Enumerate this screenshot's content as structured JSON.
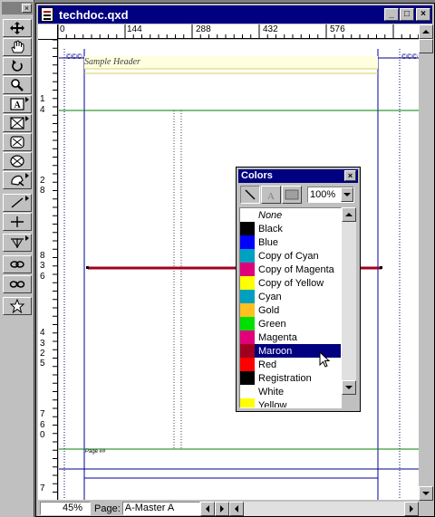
{
  "tools_palette": {
    "tools": [
      {
        "name": "item-tool-icon"
      },
      {
        "name": "content-tool-icon"
      },
      {
        "name": "rotation-tool-icon"
      },
      {
        "name": "zoom-tool-icon"
      },
      {
        "name": "text-box-tool-icon"
      },
      {
        "name": "rectangle-picture-box-tool-icon"
      },
      {
        "name": "rounded-picture-box-tool-icon"
      },
      {
        "name": "oval-picture-box-tool-icon"
      },
      {
        "name": "bezier-picture-box-tool-icon"
      },
      {
        "name": "line-tool-icon"
      },
      {
        "name": "orthogonal-line-tool-icon"
      },
      {
        "name": "text-path-tool-icon"
      },
      {
        "name": "linking-tool-icon"
      },
      {
        "name": "unlinking-tool-icon"
      },
      {
        "name": "star-tool-icon"
      }
    ]
  },
  "window": {
    "title": "techdoc.qxd",
    "minimize": "_",
    "maximize": "□",
    "close": "×"
  },
  "ruler": {
    "horizontal_labels": [
      "0",
      "144",
      "288",
      "432",
      "576"
    ],
    "vertical_labels": [
      "1",
      "4",
      "2",
      "8",
      "8",
      "3",
      "6",
      "4",
      "3",
      "2",
      "5",
      "7",
      "6",
      "0",
      "7",
      "2",
      "0",
      "8"
    ]
  },
  "page": {
    "header_text": "Sample Header",
    "footer_text": "Page ##",
    "corner_marks": "©©©"
  },
  "colors_palette": {
    "title": "Colors",
    "close": "×",
    "tint_value": "100%",
    "colors": [
      {
        "name": "None",
        "color": "#ffffff",
        "italic": true
      },
      {
        "name": "Black",
        "color": "#000000"
      },
      {
        "name": "Blue",
        "color": "#0000ff"
      },
      {
        "name": "Copy of Cyan",
        "color": "#00a0c0"
      },
      {
        "name": "Copy of Magenta",
        "color": "#e0007a"
      },
      {
        "name": "Copy of Yellow",
        "color": "#ffff00"
      },
      {
        "name": "Cyan",
        "color": "#00a0c0"
      },
      {
        "name": "Gold",
        "color": "#ffc020"
      },
      {
        "name": "Green",
        "color": "#00e000"
      },
      {
        "name": "Magenta",
        "color": "#e0007a"
      },
      {
        "name": "Maroon",
        "color": "#a00020",
        "selected": true
      },
      {
        "name": "Red",
        "color": "#ff0000"
      },
      {
        "name": "Registration",
        "color": "#000000"
      },
      {
        "name": "White",
        "color": "#ffffff"
      },
      {
        "name": "Yellow",
        "color": "#ffff00"
      }
    ]
  },
  "status_bar": {
    "zoom": "45%",
    "page_label": "Page:",
    "page_value": "A-Master A"
  },
  "accent_colors": {
    "titlebar": "#000080",
    "maroon_line": "#a00020",
    "margin_guide": "#0000a0",
    "column_guide": "#008000"
  }
}
